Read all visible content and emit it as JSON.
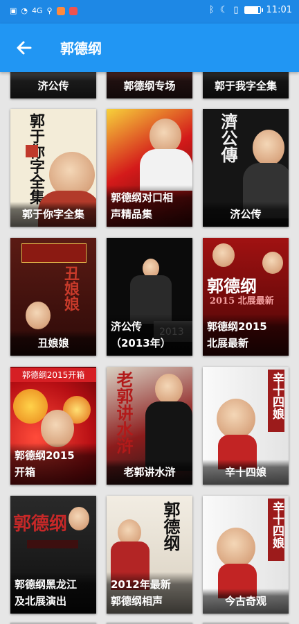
{
  "status": {
    "left_text": "4G",
    "time": "11:01",
    "battery_level": 0.9
  },
  "app_bar": {
    "title": "郭德纲"
  },
  "top_row": [
    "济公传",
    "郭德纲专场",
    "郭于我字全集"
  ],
  "cards": [
    {
      "title": "郭于你字全集"
    },
    {
      "title": "郭德纲对口相\n声精品集"
    },
    {
      "title": "济公传"
    },
    {
      "title": "丑娘娘"
    },
    {
      "title": "济公传\n（2013年）"
    },
    {
      "title": "郭德纲2015\n北展最新"
    },
    {
      "title": "郭德纲2015\n开箱"
    },
    {
      "title": "老郭讲水浒"
    },
    {
      "title": "辛十四娘"
    },
    {
      "title": "郭德纲黑龙江\n及北展演出"
    },
    {
      "title": "2012年最新\n郭德纲相声"
    },
    {
      "title": "今古奇观"
    }
  ],
  "art_text": {
    "c1": "郭于你字全集",
    "c3": "濟公傳",
    "c4": "丑娘娘",
    "c6_main": "郭德纲",
    "c6_sub": "2015 北展最新",
    "c7_banner": "郭德纲2015开箱",
    "c8_main": "老郭讲水浒",
    "c9": "辛十四娘",
    "c10": "郭德纲",
    "c11": "郭德纲",
    "c12": "辛十四娘",
    "c5_year": "2013"
  },
  "colors": {
    "app_bar": "#2196f3",
    "status_bar": "#1e88e5",
    "background": "#e6e6e6"
  }
}
